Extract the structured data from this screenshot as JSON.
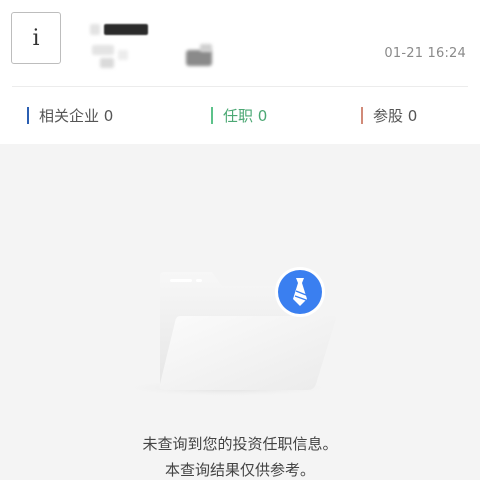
{
  "header": {
    "info_icon_glyph": "i",
    "timestamp": "01-21 16:24"
  },
  "tabs": [
    {
      "label": "相关企业 0",
      "accent": "#2b5fb2"
    },
    {
      "label": "任职 0",
      "accent": "#5cc28a",
      "active": true
    },
    {
      "label": "参股 0",
      "accent": "#d18a78"
    }
  ],
  "empty_state": {
    "icon": "empty-folder-with-tie-badge-icon",
    "line1": "未查询到您的投资任职信息。",
    "line2": "本查询结果仅供参考。"
  }
}
